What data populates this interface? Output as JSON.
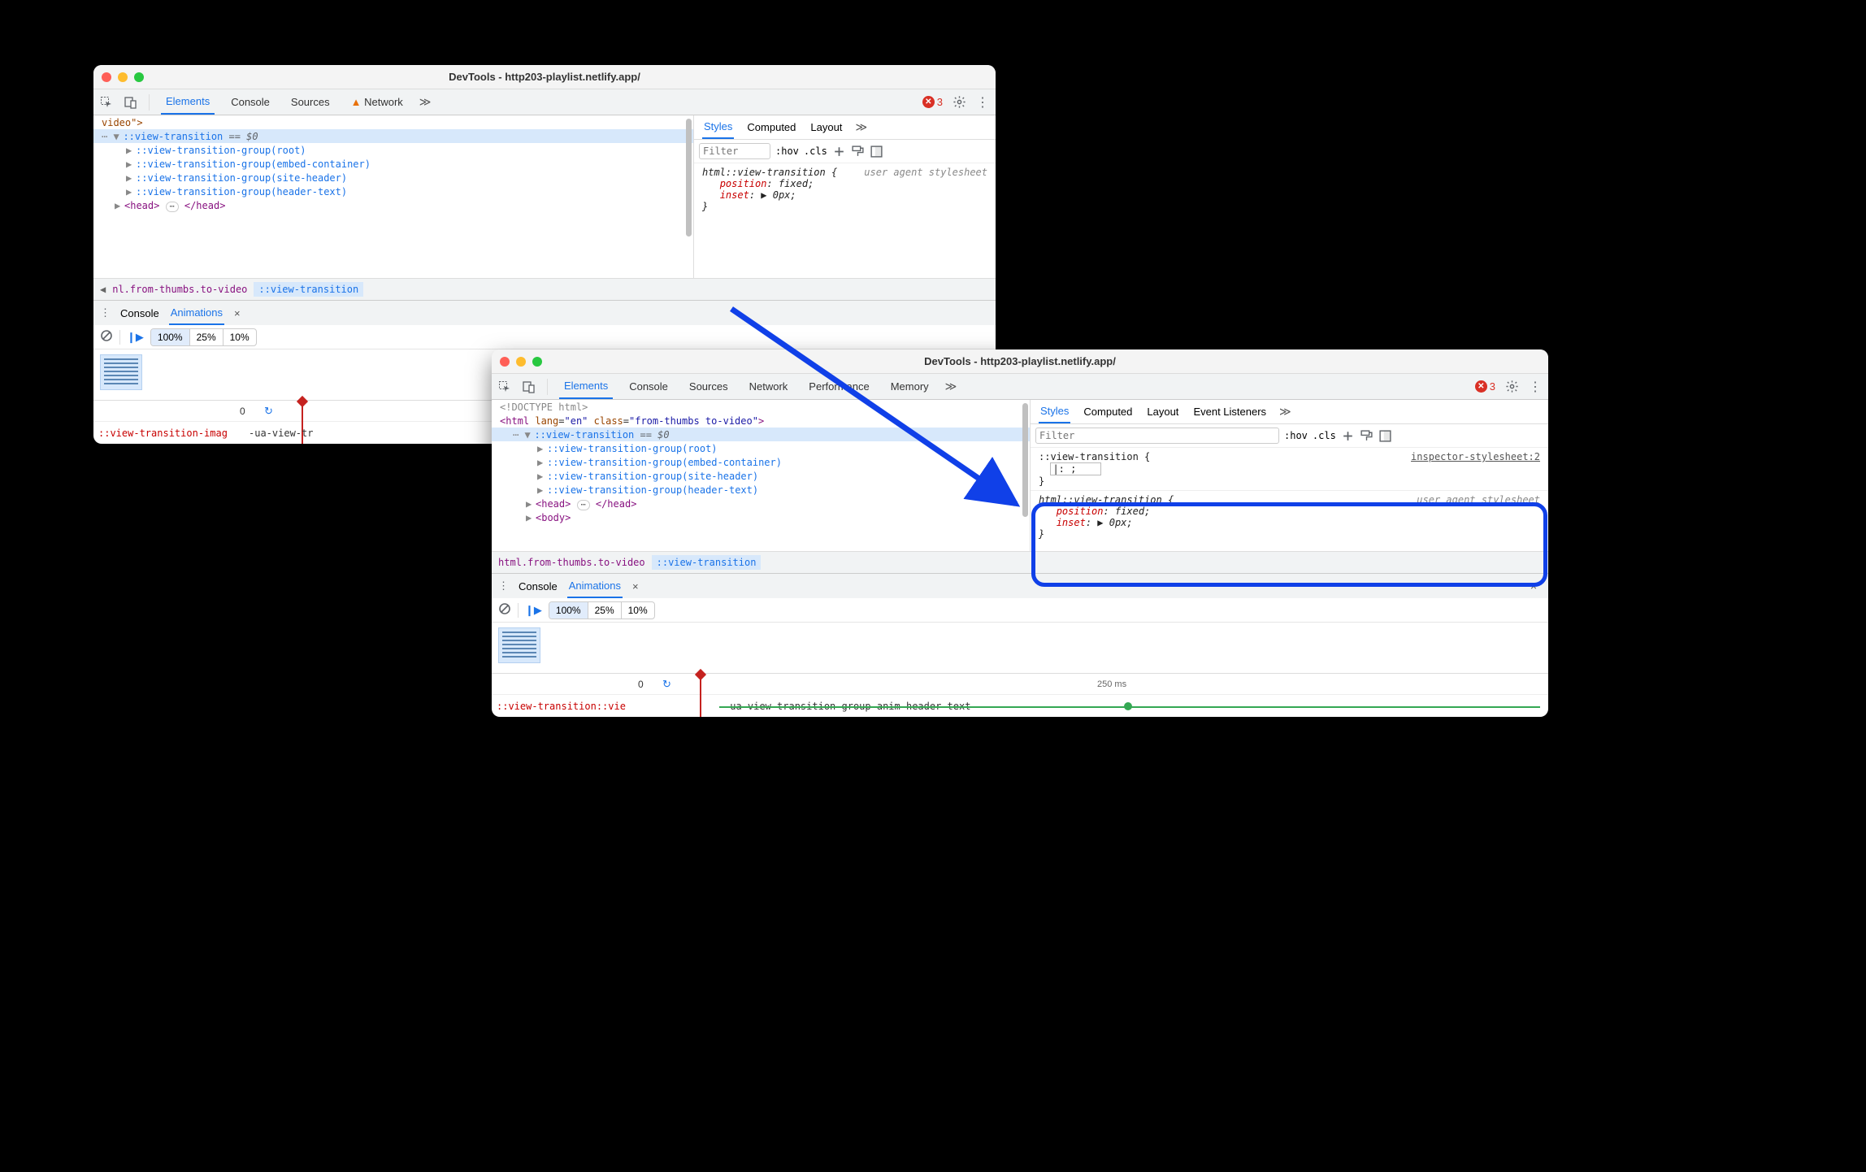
{
  "window_title": "DevTools - http203-playlist.netlify.app/",
  "main_tabs": {
    "elements": "Elements",
    "console": "Console",
    "sources": "Sources",
    "network": "Network",
    "performance": "Performance",
    "memory": "Memory"
  },
  "errors_count": "3",
  "styles_tabs": {
    "styles": "Styles",
    "computed": "Computed",
    "layout": "Layout",
    "event_listeners": "Event Listeners"
  },
  "filter_placeholder": "Filter",
  "filter_hov": ":hov",
  "filter_cls": ".cls",
  "dom1": {
    "video_end": "video\">",
    "vt": "::view-transition",
    "eq0": " == $0",
    "g_root": "::view-transition-group(root)",
    "g_embed": "::view-transition-group(embed-container)",
    "g_site": "::view-transition-group(site-header)",
    "g_header": "::view-transition-group(header-text)",
    "head_open": "<head>",
    "head_ell": "⋯",
    "head_close": "</head>"
  },
  "dom2": {
    "doctype": "<!DOCTYPE html>",
    "html_open_pre": "<html ",
    "html_lang_attr": "lang",
    "html_lang_val": "\"en\"",
    "html_class_attr": "class",
    "html_class_val": "\"from-thumbs to-video\"",
    "html_close": ">",
    "vt": "::view-transition",
    "eq0": " == $0",
    "g_root": "::view-transition-group(root)",
    "g_embed": "::view-transition-group(embed-container)",
    "g_site": "::view-transition-group(site-header)",
    "g_header": "::view-transition-group(header-text)",
    "head_open": "<head>",
    "head_ell": "⋯",
    "head_close": "</head>",
    "body_open": "<body>"
  },
  "crumb1": {
    "back": "◀",
    "path": "nl.from-thumbs.to-video",
    "active": "::view-transition"
  },
  "crumb2": {
    "path": "html.from-thumbs.to-video",
    "active": "::view-transition"
  },
  "rule1": {
    "selector": "html::view-transition {",
    "source": "user agent stylesheet",
    "p1": "position",
    "v1": "fixed",
    "p2": "inset",
    "v2": "▶ 0px",
    "close": "}"
  },
  "rule2_insp": {
    "selector": "::view-transition {",
    "source": "inspector-stylesheet:2",
    "editing": "|:  ;",
    "close": "}"
  },
  "drawer": {
    "kebab": "⋮",
    "console": "Console",
    "animations": "Animations",
    "close": "×"
  },
  "anim": {
    "speed100": "100%",
    "speed25": "25%",
    "speed10": "10%",
    "origin": "0",
    "ruler2": "250 ms",
    "row1_name_a": "::view-transition-imag",
    "row1_name_trunc": "::view-transition::vie",
    "row1_name_b": "-ua-view-tr",
    "row1_name_b_full": "-ua-view-transition-group-anim-header-text"
  }
}
